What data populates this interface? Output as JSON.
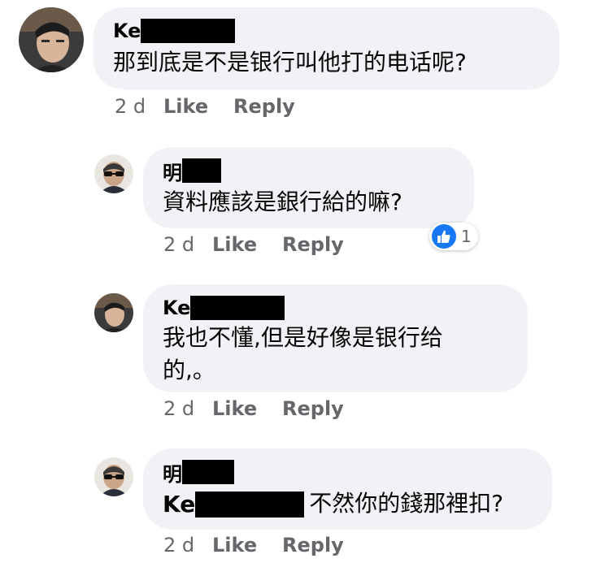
{
  "comments": [
    {
      "author_visible": "Ke",
      "text": "那到底是不是银行叫他打的电话呢?",
      "time": "2 d",
      "like_label": "Like",
      "reply_label": "Reply"
    },
    {
      "author_visible": "明",
      "text": "資料應該是銀行給的嘛?",
      "time": "2 d",
      "like_label": "Like",
      "reply_label": "Reply",
      "reaction": {
        "icon": "thumbs-up-icon",
        "count": "1",
        "color": "#1877f2"
      }
    },
    {
      "author_visible": "Ke",
      "text_line1": "我也不懂,但是好像是银行给",
      "text_line2": "的,。",
      "time": "2 d",
      "like_label": "Like",
      "reply_label": "Reply"
    },
    {
      "author_visible": "明",
      "mention_visible": "Ke",
      "text": "不然你的錢那裡扣?",
      "time": "2 d",
      "like_label": "Like",
      "reply_label": "Reply"
    }
  ],
  "colors": {
    "bubble": "#f0f2f5",
    "secondary_text": "#65676b",
    "redaction": "#000000"
  }
}
